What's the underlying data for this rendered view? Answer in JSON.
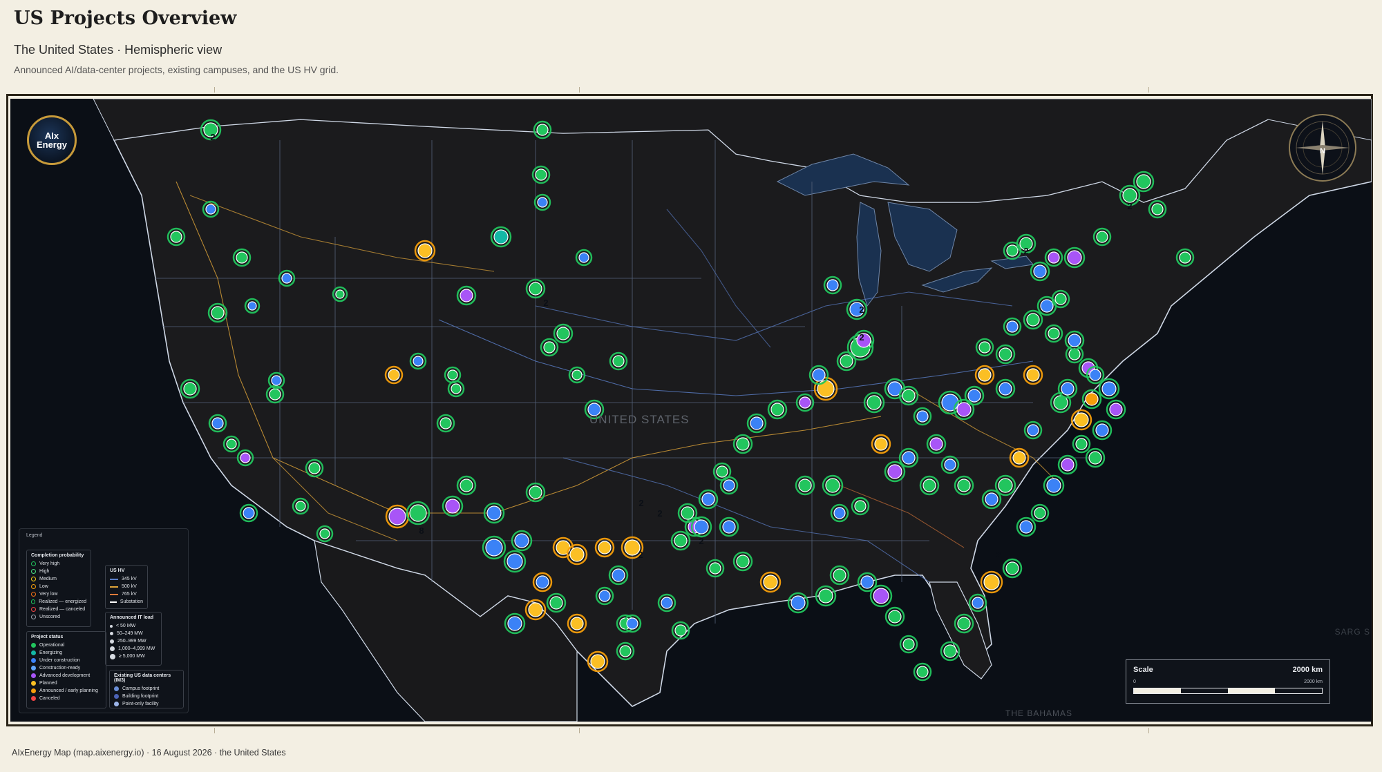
{
  "header": {
    "title": "US Projects Overview",
    "subtitle": "The United States · Hemispheric view",
    "description": "Announced AI/data-center projects, existing campuses, and the US HV grid."
  },
  "map": {
    "badge_text": "AIx Energy",
    "badge_icon": "aix-energy-logo-icon",
    "compass_north": "N",
    "country_label": "UNITED STATES",
    "bahamas_label": "THE BAHAMAS",
    "sargasso_label": "SARG S",
    "cluster_counts": [
      "2",
      "2",
      "2",
      "2",
      "2",
      "2",
      "2",
      "2",
      "2",
      "2",
      "2",
      "8"
    ]
  },
  "legend": {
    "title": "Legend",
    "completion": {
      "title": "Completion probability",
      "items": [
        {
          "label": "Very high",
          "color": "#22c55e"
        },
        {
          "label": "High",
          "color": "#4ade80"
        },
        {
          "label": "Medium",
          "color": "#facc15"
        },
        {
          "label": "Low",
          "color": "#f59e0b"
        },
        {
          "label": "Very low",
          "color": "#f97316"
        },
        {
          "label": "Realized — energized",
          "color": "#22c55e"
        },
        {
          "label": "Realized — canceled",
          "color": "#ef4444"
        },
        {
          "label": "Unscored",
          "color": "#9ca3af"
        }
      ]
    },
    "status": {
      "title": "Project status",
      "items": [
        {
          "label": "Operational",
          "color": "#22c55e"
        },
        {
          "label": "Energizing",
          "color": "#14b8a6"
        },
        {
          "label": "Under construction",
          "color": "#3b82f6"
        },
        {
          "label": "Construction-ready",
          "color": "#60a5fa"
        },
        {
          "label": "Advanced development",
          "color": "#a855f7"
        },
        {
          "label": "Planned",
          "color": "#fbbf24"
        },
        {
          "label": "Announced / early planning",
          "color": "#f59e0b"
        },
        {
          "label": "Canceled",
          "color": "#ef4444"
        }
      ]
    },
    "hv": {
      "title": "US HV",
      "items": [
        {
          "label": "345 kV",
          "color": "#5b7fc9"
        },
        {
          "label": "500 kV",
          "color": "#e0a53a"
        },
        {
          "label": "765 kV",
          "color": "#e07a3a"
        },
        {
          "label": "Substation",
          "color": "#ffffff"
        }
      ]
    },
    "load": {
      "title": "Announced IT load",
      "items": [
        "< 50 MW",
        "50–249 MW",
        "250–999 MW",
        "1,000–4,999 MW",
        "≥ 5,000 MW"
      ]
    },
    "existing": {
      "title": "Existing US data centers (IM3)",
      "items": [
        {
          "label": "Campus footprint",
          "color": "#6a8ed6"
        },
        {
          "label": "Building footprint",
          "color": "#4c63b6"
        },
        {
          "label": "Point-only facility",
          "color": "#9bb4e8"
        }
      ]
    }
  },
  "scale": {
    "label": "Scale",
    "value": "2000 km",
    "zero": "0",
    "end": "2000 km"
  },
  "footer": {
    "source": "AIxEnergy Map (map.aixenergy.io)",
    "date": "16 August 2026",
    "region": "the United States"
  },
  "colors": {
    "background": "#f3efe3",
    "map_background": "#0b0f16",
    "land": "#1b1b1d",
    "lakes": "#1a3150",
    "accent_frame": "#c79a3a"
  }
}
